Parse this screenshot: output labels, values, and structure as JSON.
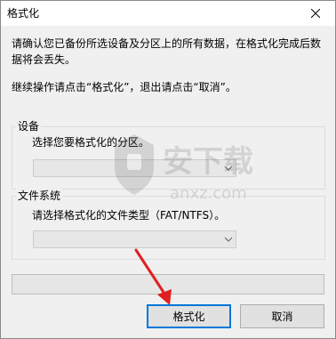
{
  "window": {
    "title": "格式化"
  },
  "message": {
    "warning": "请确认您已备份所选设备及分区上的所有数据，在格式化完成后数据将会丢失。",
    "continue": "继续操作请点击“格式化”，退出请点击“取消”。"
  },
  "device_group": {
    "legend": "设备",
    "prompt": "选择您要格式化的分区。",
    "selected": ""
  },
  "fs_group": {
    "legend": "文件系统",
    "prompt": "请选择格式化的文件类型（FAT/NTFS）。",
    "selected": ""
  },
  "progress": {
    "value": 0
  },
  "buttons": {
    "format": "格式化",
    "cancel": "取消"
  },
  "watermark": {
    "text": "安下载",
    "domain": "anxz.com"
  },
  "colors": {
    "annotation_arrow": "#e02020",
    "default_button_border": "#0078d7"
  }
}
